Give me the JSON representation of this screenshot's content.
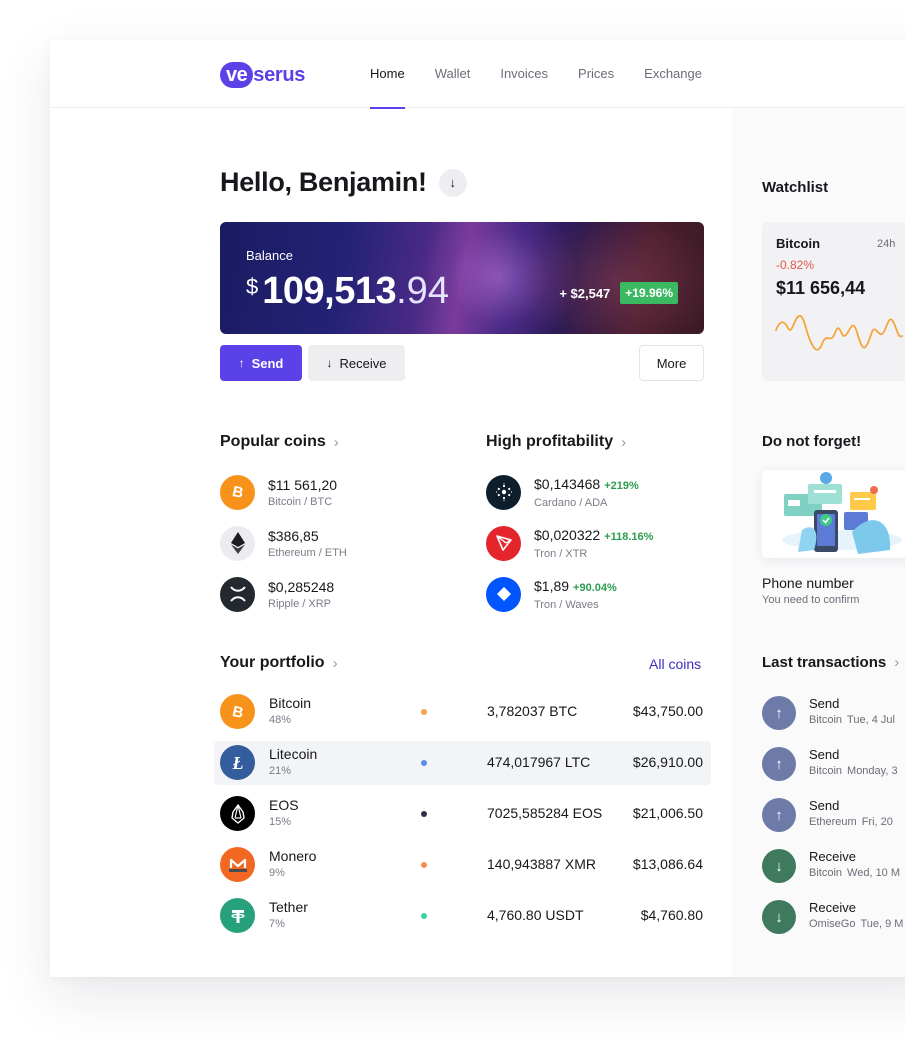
{
  "brand": {
    "logo_mark": "ve",
    "logo_rest": "serus",
    "color": "#5a41e8"
  },
  "nav": {
    "items": [
      {
        "label": "Home",
        "active": true
      },
      {
        "label": "Wallet",
        "active": false
      },
      {
        "label": "Invoices",
        "active": false
      },
      {
        "label": "Prices",
        "active": false
      },
      {
        "label": "Exchange",
        "active": false
      }
    ]
  },
  "greeting": {
    "title": "Hello, Benjamin!",
    "icon": "arrow-down-icon"
  },
  "balance": {
    "label": "Balance",
    "currency": "$",
    "amount_int": "109,513",
    "amount_dec": ".94",
    "change_abs": "+ $2,547",
    "change_pct": "+19.96%"
  },
  "actions": {
    "send": "Send",
    "receive": "Receive",
    "more": "More"
  },
  "popular": {
    "title": "Popular coins",
    "items": [
      {
        "price": "$11 561,20",
        "name": "Bitcoin / BTC",
        "icon": "bitcoin-icon",
        "color": "#f7931a"
      },
      {
        "price": "$386,85",
        "name": "Ethereum / ETH",
        "icon": "ethereum-icon",
        "color": "#ececf0"
      },
      {
        "price": "$0,285248",
        "name": "Ripple / XRP",
        "icon": "ripple-icon",
        "color": "#23292f"
      }
    ]
  },
  "profitability": {
    "title": "High profitability",
    "items": [
      {
        "price": "$0,143468",
        "pct": "+219%",
        "name": "Cardano / ADA",
        "icon": "cardano-icon",
        "color": "#0d1e2d"
      },
      {
        "price": "$0,020322",
        "pct": "+118.16%",
        "name": "Tron / XTR",
        "icon": "tron-icon",
        "color": "#e5252c"
      },
      {
        "price": "$1,89",
        "pct": "+90.04%",
        "name": "Tron / Waves",
        "icon": "waves-icon",
        "color": "#0055ff"
      }
    ]
  },
  "portfolio": {
    "title": "Your portfolio",
    "all_coins": "All coins",
    "rows": [
      {
        "name": "Bitcoin",
        "share": "48%",
        "qty": "3,782037 BTC",
        "usd": "$43,750.00",
        "icon": "bitcoin-icon",
        "color": "#f7931a",
        "dot": "#f5a04a"
      },
      {
        "name": "Litecoin",
        "share": "21%",
        "qty": "474,017967 LTC",
        "usd": "$26,910.00",
        "icon": "litecoin-icon",
        "color": "#345d9d",
        "dot": "#5b8de0"
      },
      {
        "name": "EOS",
        "share": "15%",
        "qty": "7025,585284 EOS",
        "usd": "$21,006.50",
        "icon": "eos-icon",
        "color": "#000000",
        "dot": "#2b3043"
      },
      {
        "name": "Monero",
        "share": "9%",
        "qty": "140,943887 XMR",
        "usd": "$13,086.64",
        "icon": "monero-icon",
        "color": "#f26822",
        "dot": "#f5904a"
      },
      {
        "name": "Tether",
        "share": "7%",
        "qty": "4,760.80 USDT",
        "usd": "$4,760.80",
        "icon": "tether-icon",
        "color": "#26a17b",
        "dot": "#3ed39a"
      }
    ]
  },
  "watchlist": {
    "title": "Watchlist",
    "coin": "Bitcoin",
    "period": "24h",
    "change": "-0.82%",
    "price": "$11 656,44",
    "spark_color": "#f4a63a"
  },
  "reminder": {
    "title": "Do not forget!",
    "item_title": "Phone number",
    "item_sub": "You need to confirm"
  },
  "transactions": {
    "title": "Last transactions",
    "items": [
      {
        "type": "Send",
        "coin": "Bitcoin",
        "date": "Tue, 4 Jul",
        "dir": "send"
      },
      {
        "type": "Send",
        "coin": "Bitcoin",
        "date": "Monday, 3",
        "dir": "send"
      },
      {
        "type": "Send",
        "coin": "Ethereum",
        "date": "Fri, 20",
        "dir": "send"
      },
      {
        "type": "Receive",
        "coin": "Bitcoin",
        "date": "Wed, 10 M",
        "dir": "recv"
      },
      {
        "type": "Receive",
        "coin": "OmiseGo",
        "date": "Tue, 9 M",
        "dir": "recv"
      }
    ]
  }
}
